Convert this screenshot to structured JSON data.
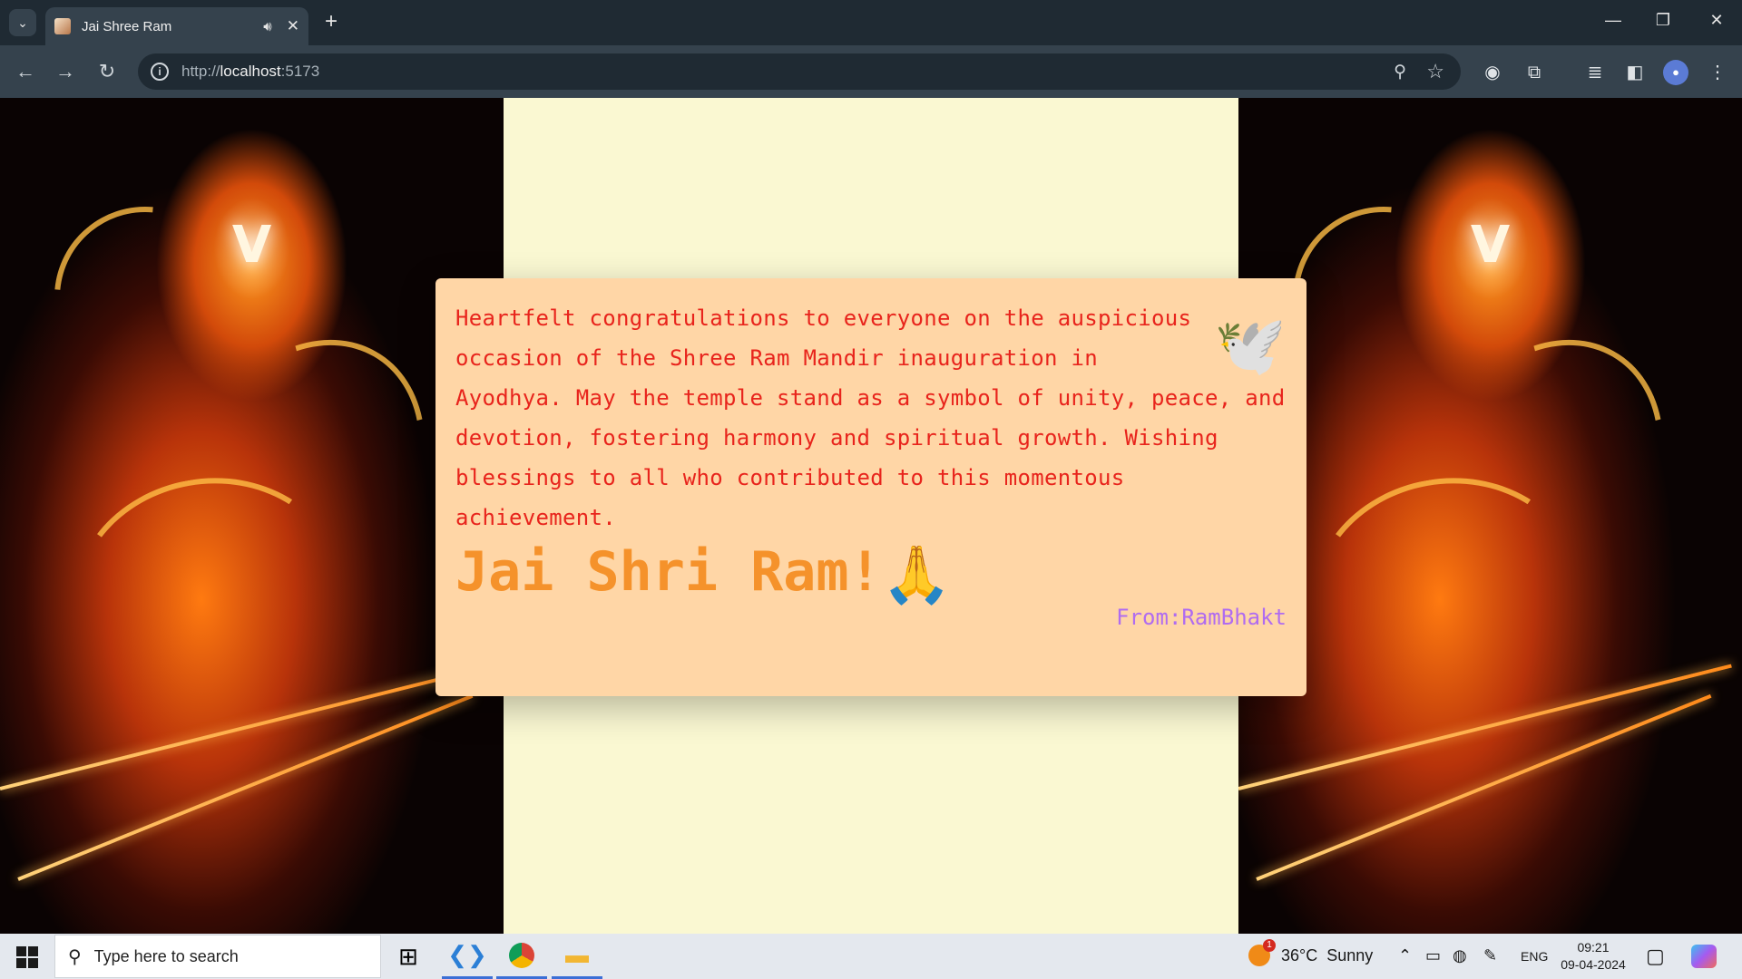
{
  "browser": {
    "tab_title": "Jai Shree Ram",
    "url_scheme": "http://",
    "url_host": "localhost",
    "url_port": ":5173",
    "icons": [
      "tab-search-icon",
      "speaker-icon",
      "close-icon",
      "plus-icon",
      "minimize-icon",
      "restore-icon",
      "close-window-icon",
      "back-icon",
      "forward-icon",
      "reload-icon",
      "info-icon",
      "zoom-icon",
      "star-icon",
      "extension-icon",
      "puzzle-icon",
      "media-icon",
      "sidepanel-icon",
      "profile-icon",
      "menu-icon"
    ]
  },
  "page": {
    "message": "Heartfelt congratulations to everyone on the auspicious occasion of the Shree Ram Mandir inauguration in Ayodhya. May the temple stand as a symbol of unity, peace, and devotion, fostering harmony and spiritual growth. Wishing blessings to all who contributed to this momentous achievement.",
    "dove_emoji": "🕊️",
    "greeting": "Jai Shri Ram!",
    "pray_emoji": "🙏",
    "signature": "From:RamBhakt",
    "colors": {
      "card_bg": "#ffd6a6",
      "center_bg": "#faf8d2",
      "message_text": "#e8241c",
      "greeting_text": "#f5922b",
      "signature_text": "#b06cf0"
    }
  },
  "taskbar": {
    "search_placeholder": "Type here to search",
    "weather_temp": "36°C",
    "weather_desc": "Sunny",
    "weather_alerts": "1",
    "language": "ENG",
    "time": "09:21",
    "date": "09-04-2024",
    "apps": [
      "task-view",
      "vscode",
      "chrome",
      "file-explorer"
    ]
  }
}
